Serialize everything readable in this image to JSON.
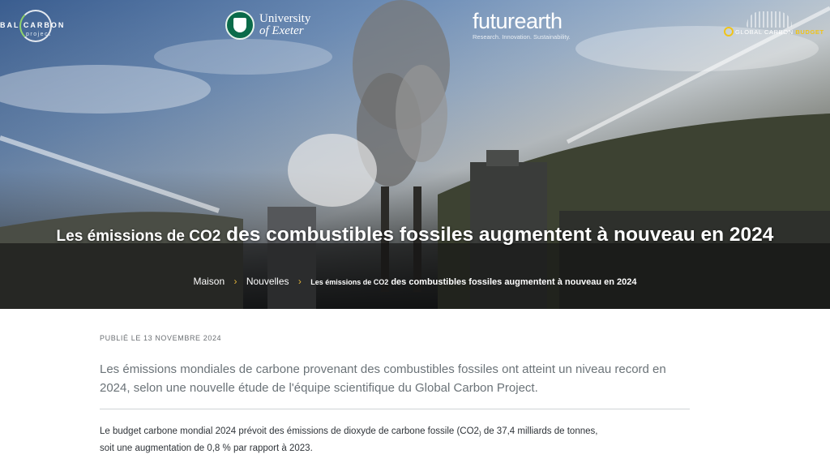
{
  "logos": {
    "gcp_text": "BAL CARBON",
    "gcp_sub": "project",
    "exeter_line1": "University",
    "exeter_line2": "of Exeter",
    "future_title": "futurearth",
    "future_tagline": "Research. Innovation. Sustainability.",
    "gcb_prefix": "GLOBAL CARBON ",
    "gcb_bold": "BUDGET"
  },
  "hero": {
    "title_pre": "Les émissions de CO2",
    "title_main": " des combustibles fossiles augmentent à nouveau en 2024"
  },
  "breadcrumb": {
    "home": "Maison",
    "news": "Nouvelles",
    "separator": "›",
    "current_pre": "Les émissions de CO2",
    "current_main": " des combustibles fossiles augmentent à nouveau en 2024"
  },
  "article": {
    "published": "PUBLIÉ LE 13 NOVEMBRE 2024",
    "lead": "Les émissions mondiales de carbone provenant des combustibles fossiles ont atteint un niveau record en 2024, selon une nouvelle étude de l'équipe scientifique du Global Carbon Project.",
    "body_part1": "Le budget carbone mondial 2024 prévoit des émissions de dioxyde de carbone fossile (CO2",
    "body_sub": ")",
    "body_part2": " de 37,4 milliards de tonnes, soit une augmentation de 0,8 % par rapport à 2023."
  },
  "colors": {
    "accent_gold": "#e0b23a",
    "exeter_green": "#0b6b4a",
    "gcb_yellow": "#f0c419"
  }
}
